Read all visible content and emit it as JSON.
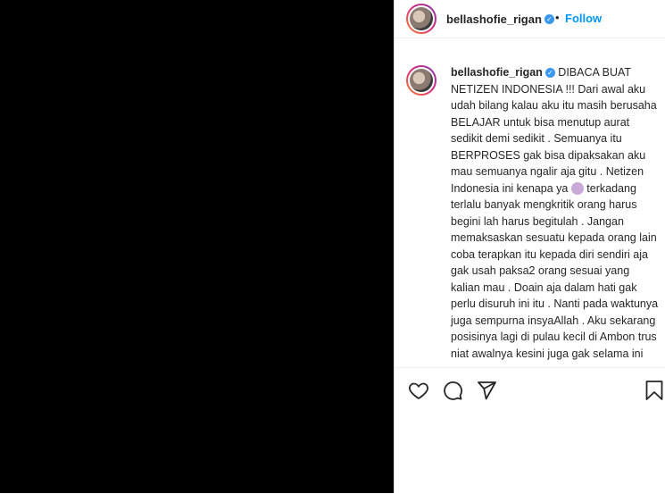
{
  "post": {
    "username": "bellashofie_rigan",
    "verified_glyph": "✓",
    "separator": "•",
    "follow_label": "Follow",
    "caption_text": " DIBACA BUAT NETIZEN INDONESIA !!! Dari awal aku udah bilang kalau aku itu masih berusaha BELAJAR untuk bisa menutup aurat sedikit demi sedikit . Semuanya itu BERPROSES gak bisa dipaksakan aku mau semuanya ngalir aja gitu . Netizen Indonesia ini kenapa ya ",
    "caption_text_2": " terkadang terlalu banyak mengkritik orang harus begini lah harus begitulah . Jangan memaksaskan sesuatu kepada orang lain coba terapkan itu kepada diri sendiri aja gak usah paksa2 orang sesuai yang kalian mau . Doain aja dalam hati gak perlu disuruh ini itu . Nanti pada waktunya juga sempurna insyaAllah . Aku sekarang posisinya lagi di pulau kecil di Ambon trus niat awalnya kesini juga gak selama ini"
  },
  "icons": {
    "like": "heart-icon",
    "comment": "comment-icon",
    "share": "send-icon",
    "save": "bookmark-icon"
  },
  "colors": {
    "media_bg": "#000000",
    "link_blue": "#0095f6",
    "text": "#262626"
  }
}
